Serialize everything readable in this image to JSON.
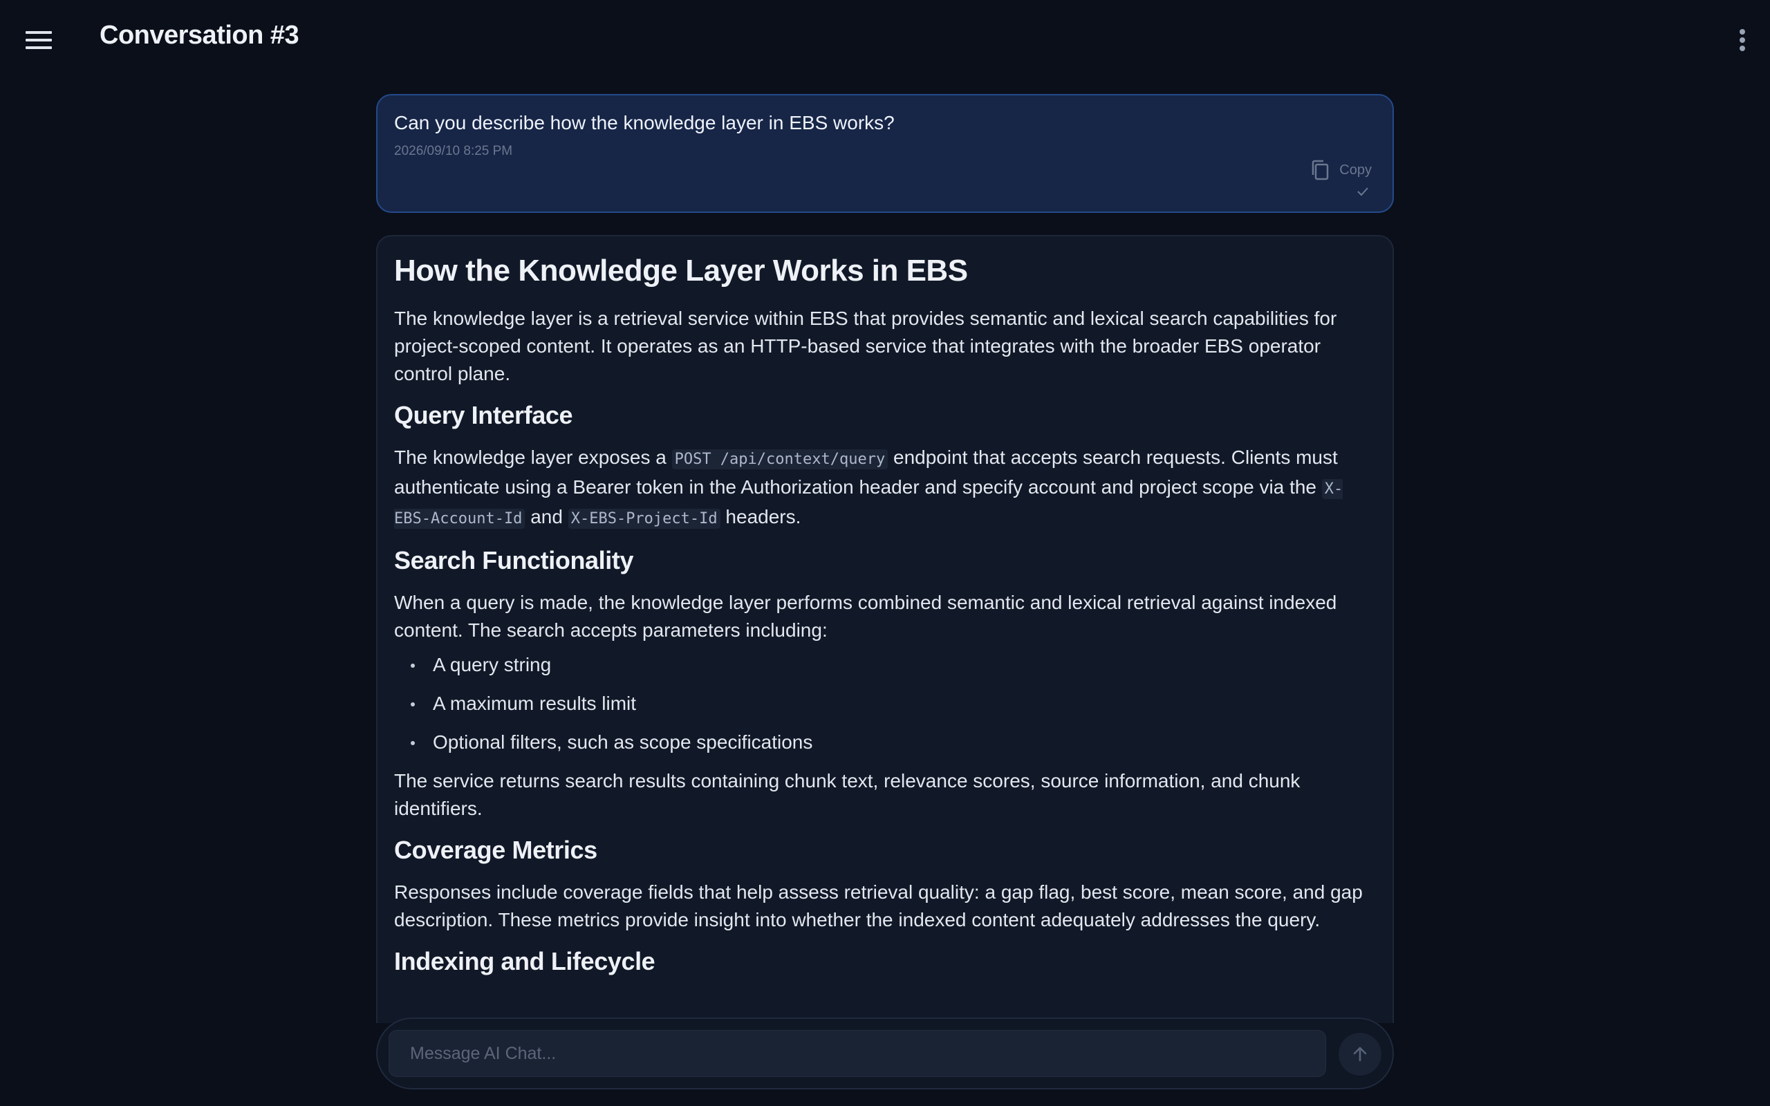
{
  "header": {
    "title": "Conversation #3"
  },
  "user_message": {
    "text": "Can you describe how the knowledge layer in EBS works?",
    "timestamp": "2026/09/10 8:25 PM",
    "copy_label": "Copy"
  },
  "assistant_message": {
    "heading": "How the Knowledge Layer Works in EBS",
    "intro": "The knowledge layer is a retrieval service within EBS that provides semantic and lexical search capabilities for project-scoped content. It operates as an HTTP-based service that integrates with the broader EBS operator control plane.",
    "query_heading": "Query Interface",
    "query_p_a": "The knowledge layer exposes a ",
    "query_code_endpoint": "POST /api/context/query",
    "query_p_b": " endpoint that accepts search requests. Clients must authenticate using a Bearer token in the Authorization header and specify account and project scope via the ",
    "query_code_account": "X-EBS-Account-Id",
    "query_p_c": " and ",
    "query_code_project": "X-EBS-Project-Id",
    "query_p_d": " headers.",
    "search_heading": "Search Functionality",
    "search_p": "When a query is made, the knowledge layer performs combined semantic and lexical retrieval against indexed content. The search accepts parameters including:",
    "search_items": [
      "A query string",
      "A maximum results limit",
      "Optional filters, such as scope specifications"
    ],
    "search_result_p": "The service returns search results containing chunk text, relevance scores, source information, and chunk identifiers.",
    "coverage_heading": "Coverage Metrics",
    "coverage_p": "Responses include coverage fields that help assess retrieval quality: a gap flag, best score, mean score, and gap description. These metrics provide insight into whether the indexed content adequately addresses the query.",
    "indexing_heading": "Indexing and Lifecycle"
  },
  "composer": {
    "placeholder": "Message AI Chat..."
  },
  "colors": {
    "background": "#0a0f1a",
    "user_bubble": "#172647",
    "user_bubble_border": "#244a8a",
    "assistant_panel": "#111827"
  }
}
